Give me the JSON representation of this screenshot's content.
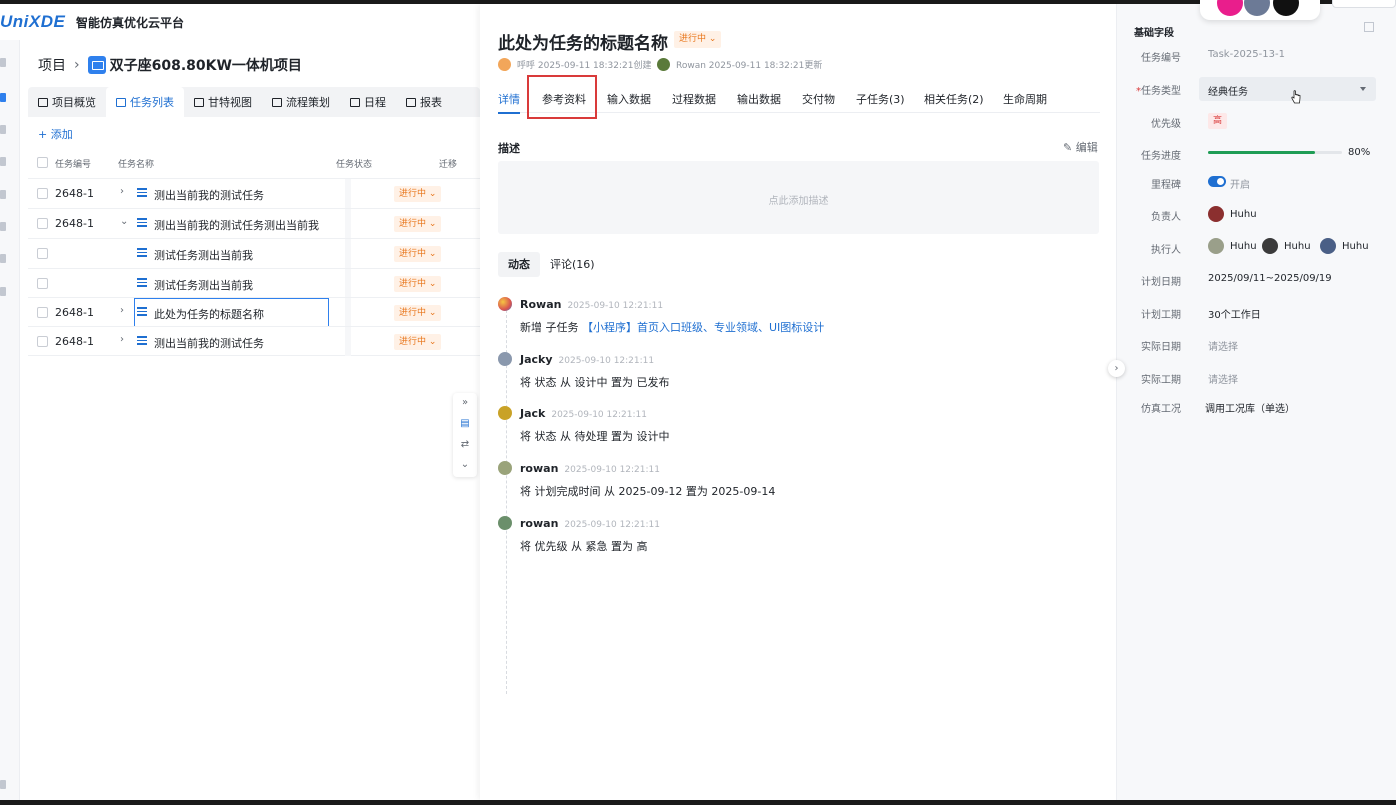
{
  "app": {
    "logo": "UniXDE",
    "title": "智能仿真优化云平台"
  },
  "breadcrumb": {
    "root": "项目",
    "project": "双子座608.80KW一体机项目"
  },
  "view_tabs": [
    {
      "label": "项目概览"
    },
    {
      "label": "任务列表",
      "active": true
    },
    {
      "label": "甘特视图"
    },
    {
      "label": "流程策划"
    },
    {
      "label": "日程"
    },
    {
      "label": "报表"
    }
  ],
  "add_label": "+ 添加",
  "table": {
    "headers": {
      "code": "任务编号",
      "name": "任务名称",
      "status": "任务状态",
      "move": "迁移"
    },
    "rows": [
      {
        "code": "2648-1",
        "expander": "›",
        "name": "测出当前我的测试任务",
        "status": "进行中 ⌄"
      },
      {
        "code": "2648-1",
        "expander": "⌄",
        "name": "测出当前我的测试任务测出当前我",
        "status": "进行中 ⌄"
      },
      {
        "code": "",
        "expander": "",
        "name": "测试任务测出当前我",
        "status": "进行中 ⌄"
      },
      {
        "code": "",
        "expander": "",
        "name": "测试任务测出当前我",
        "status": "进行中 ⌄"
      },
      {
        "code": "2648-1",
        "expander": "›",
        "name": "此处为任务的标题名称",
        "status": "进行中 ⌄",
        "selected": true
      },
      {
        "code": "2648-1",
        "expander": "›",
        "name": "测出当前我的测试任务",
        "status": "进行中 ⌄"
      }
    ]
  },
  "float_tools": {
    "expand": "»",
    "doc": "▤",
    "swap": "⇄",
    "down": "⌄"
  },
  "detail": {
    "title": "此处为任务的标题名称",
    "status": "进行中 ⌄",
    "creator": "呼呼 2025-09-11 18:32:21创建",
    "updater": "Rowan 2025-09-11 18:32:21更新",
    "tabs": [
      "详情",
      "参考资料",
      "输入数据",
      "过程数据",
      "输出数据",
      "交付物",
      "子任务(3)",
      "相关任务(2)",
      "生命周期"
    ],
    "active_tab": "详情",
    "highlighted_tab": "参考资料",
    "desc_label": "描述",
    "edit_label": "编辑",
    "desc_placeholder": "点此添加描述",
    "activity_tabs": [
      "动态",
      "评论(16)"
    ],
    "activities": [
      {
        "user": "Rowan",
        "time": "2025-09-10 12:21:11",
        "text": "新增 子任务 ",
        "link": "【小程序】首页入口班级、专业领域、UI图标设计"
      },
      {
        "user": "Jacky",
        "time": "2025-09-10 12:21:11",
        "text": "将 状态 从 设计中 置为 已发布",
        "link": ""
      },
      {
        "user": "Jack",
        "time": "2025-09-10 12:21:11",
        "text": "将 状态 从 待处理 置为 设计中",
        "link": ""
      },
      {
        "user": "rowan",
        "time": "2025-09-10 12:21:11",
        "text": "将 计划完成时间 从 2025-09-12 置为 2025-09-14",
        "link": ""
      },
      {
        "user": "rowan",
        "time": "2025-09-10 12:21:11",
        "text": "将 优先级 从 紧急 置为 高",
        "link": ""
      }
    ],
    "collapse_icon": "›"
  },
  "fields": {
    "section": "基础字段",
    "task_no": {
      "label": "任务编号",
      "value": "Task-2025-13-1"
    },
    "task_type": {
      "label": "任务类型",
      "required": "*",
      "value": "经典任务"
    },
    "priority": {
      "label": "优先级",
      "value": "高"
    },
    "progress": {
      "label": "任务进度",
      "value": "80%",
      "fraction": 0.8
    },
    "milestone": {
      "label": "里程碑",
      "value": "开启"
    },
    "owner": {
      "label": "负责人",
      "value": "Huhu"
    },
    "executors": {
      "label": "执行人",
      "values": [
        "Huhu",
        "Huhu",
        "Huhu"
      ]
    },
    "plan_date": {
      "label": "计划日期",
      "value": "2025/09/11~2025/09/19"
    },
    "plan_period": {
      "label": "计划工期",
      "value": "30个工作日"
    },
    "actual_date": {
      "label": "实际日期",
      "placeholder": "请选择"
    },
    "actual_period": {
      "label": "实际工期",
      "placeholder": "请选择"
    },
    "sim_condition": {
      "label": "仿真工况",
      "value": "调用工况库（单选）"
    }
  },
  "colors": {
    "accent": "#1f6fd1",
    "status": "#e8761b",
    "highlight_box": "#d93a3a",
    "progress": "#1f9d55"
  }
}
